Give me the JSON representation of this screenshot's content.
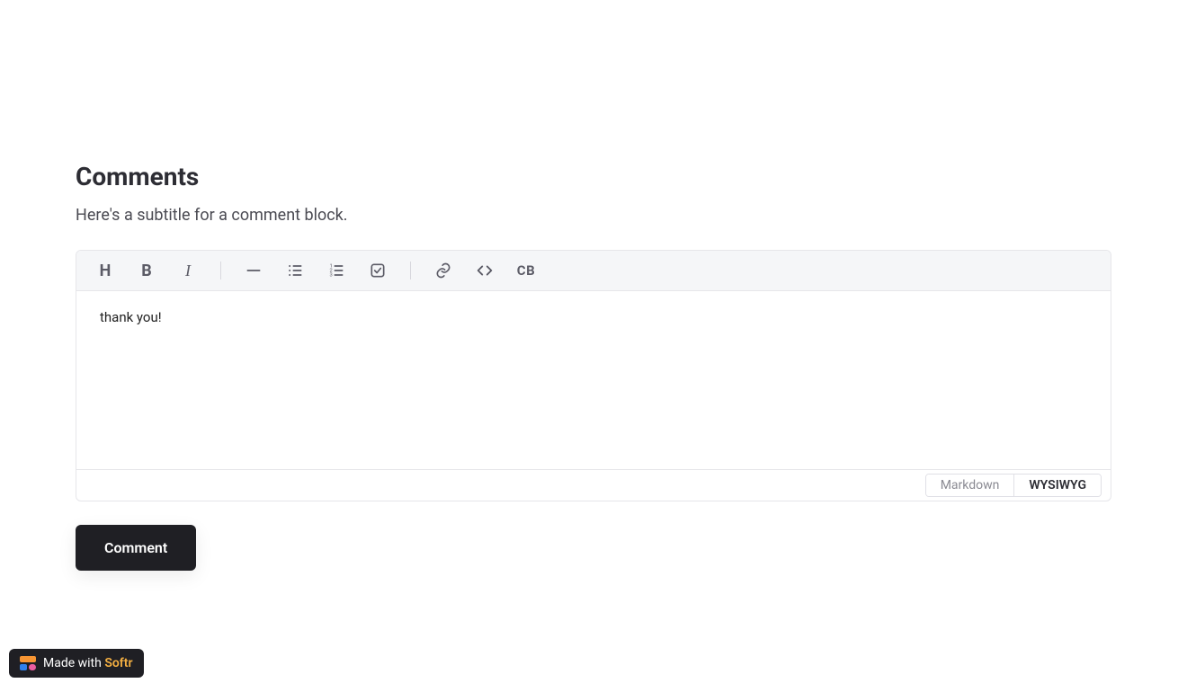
{
  "header": {
    "title": "Comments",
    "subtitle": "Here's a subtitle for a comment block."
  },
  "toolbar": {
    "heading": "H",
    "bold": "B",
    "italic": "I",
    "codeblock": "CB"
  },
  "editor": {
    "content": "thank you!"
  },
  "modes": {
    "markdown": "Markdown",
    "wysiwyg": "WYSIWYG",
    "active": "wysiwyg"
  },
  "actions": {
    "submit": "Comment"
  },
  "badge": {
    "prefix": "Made with ",
    "brand": "Softr"
  }
}
